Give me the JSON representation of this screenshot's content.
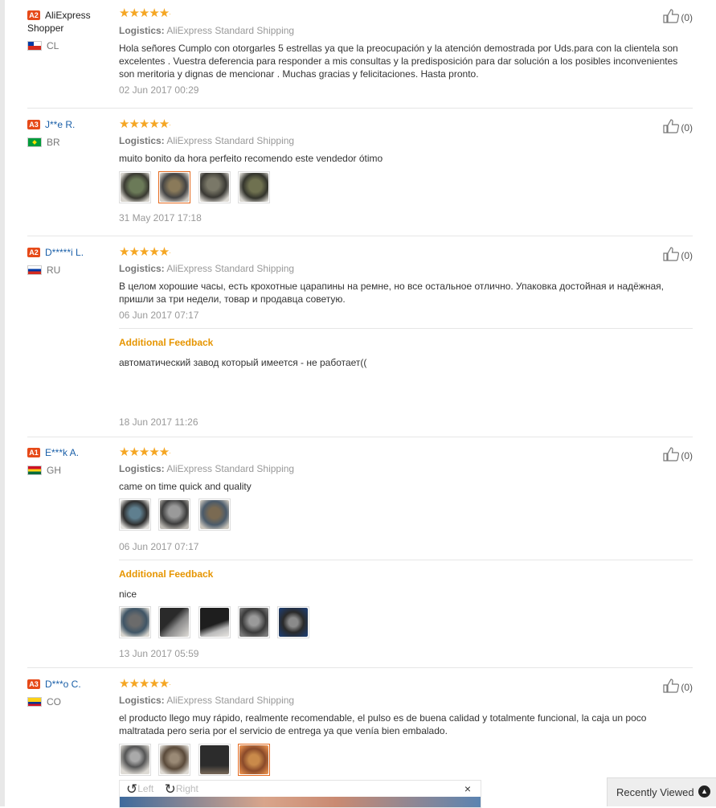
{
  "reviews": [
    {
      "badge": "A2",
      "name": "AliExpress Shopper",
      "country": "CL",
      "stars": "★★★★★",
      "logistics_label": "Logistics:",
      "logistics": "AliExpress Standard Shipping",
      "text": "Hola señores Cumplo con otorgarles 5 estrellas ya que la preocupación y la atención demostrada por Uds.para con la clientela son excelentes . Vuestra deferencia para responder a mis consultas y la predisposición para dar solución a los posibles inconvenientes son meritoria y dignas de mencionar . Muchas gracias y felicitaciones. Hasta pronto.",
      "date": "02 Jun 2017 00:29",
      "likes": "(0)"
    },
    {
      "badge": "A3",
      "name": "J**e R.",
      "country": "BR",
      "stars": "★★★★★",
      "logistics_label": "Logistics:",
      "logistics": "AliExpress Standard Shipping",
      "text": "muito bonito da hora perfeito recomendo este vendedor ótimo",
      "date": "31 May 2017 17:18",
      "likes": "(0)"
    },
    {
      "badge": "A2",
      "name": "D*****i L.",
      "country": "RU",
      "stars": "★★★★★",
      "logistics_label": "Logistics:",
      "logistics": "AliExpress Standard Shipping",
      "text": "В целом хорошие часы, есть крохотные царапины на ремне, но все остальное отлично. Упаковка достойная и надёжная, пришли за три недели, товар и продавца советую.",
      "date": "06 Jun 2017 07:17",
      "additional_label": "Additional Feedback",
      "additional_text": "автоматический завод который имеется - не работает((",
      "additional_date": "18 Jun 2017 11:26",
      "likes": "(0)"
    },
    {
      "badge": "A1",
      "name": "E***k A.",
      "country": "GH",
      "stars": "★★★★★",
      "logistics_label": "Logistics:",
      "logistics": "AliExpress Standard Shipping",
      "text": "came on time quick and quality",
      "date": "06 Jun 2017 07:17",
      "additional_label": "Additional Feedback",
      "additional_text": "nice",
      "additional_date": "13 Jun 2017 05:59",
      "likes": "(0)"
    },
    {
      "badge": "A3",
      "name": "D***o C.",
      "country": "CO",
      "stars": "★★★★★",
      "logistics_label": "Logistics:",
      "logistics": "AliExpress Standard Shipping",
      "text": "el producto llego muy rápido, realmente recomendable, el pulso es de buena calidad y totalmente funcional, la caja un poco maltratada pero seria por el servicio de entrega ya que venía bien embalado.",
      "likes": "(0)"
    }
  ],
  "viewer": {
    "left_label": "Left",
    "right_label": "Right",
    "close": "×"
  },
  "recently_viewed": {
    "label": "Recently Viewed",
    "arrow": "▲"
  },
  "icons": {
    "thumbs_up": "thumbs-up-icon",
    "rotate_left": "rotate-left-icon",
    "rotate_right": "rotate-right-icon"
  }
}
